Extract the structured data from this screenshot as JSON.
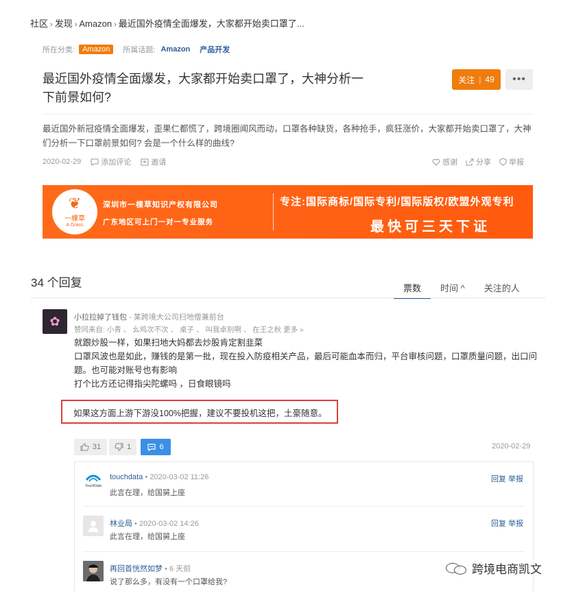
{
  "breadcrumb": {
    "items": [
      "社区",
      "发现",
      "Amazon",
      "最近国外疫情全面爆发，大家都开始卖口罩了..."
    ],
    "separator": "›"
  },
  "meta": {
    "category_label": "所在分类:",
    "category": "Amazon",
    "topics_label": "所属话题:",
    "topics": [
      "Amazon",
      "产品开发"
    ]
  },
  "question": {
    "title": "最近国外疫情全面爆发，大家都开始卖口罩了，大神分析一下前景如何?",
    "follow_label": "关注",
    "follow_count": "49",
    "more_label": "•••",
    "body": "最近国外新冠疫情全面爆发，歪果仁都慌了，跨境圈闻风而动，口罩各种缺货，各种抢手，疯狂涨价，大家都开始卖口罩了，大神们分析一下口罩前景如何? 会是一个什么样的曲线?",
    "date": "2020-02-29",
    "add_comment": "添加评论",
    "invite": "邀请",
    "thanks": "感谢",
    "share": "分享",
    "report": "举报"
  },
  "banner": {
    "logo_text": "一棵草",
    "logo_sub": "A Grass",
    "company": "深圳市一棵草知识产权有限公司",
    "service": "广东地区可上门一对一专业服务",
    "focus": "专注:国际商标/国际专利/国际版权/欧盟外观专利",
    "fast": "最快可三天下证"
  },
  "answers": {
    "count_label": "34 个回复",
    "sort_tabs": [
      "票数",
      "时间 ^",
      "关注的人"
    ],
    "active_sort": "票数"
  },
  "answer": {
    "author": "小拉拉掉了钱包",
    "author_desc": " - 某跨境大公司扫地僧兼前台",
    "likers": "赞同来自: 小青 、 幺鸡次不次 、 桌子 、 叫我卓别啊 、 在王之秋 更多 »",
    "lines": [
      "就跟炒股一样，如果扫地大妈都去炒股肯定割韭菜",
      "口罩风波也是如此，赚钱的是第一批，现在投入防疫相关产品，最后可能血本而归，平台审核问题，口罩质量问题，出口问题。也可能对账号也有影响",
      "打个比方还记得指尖陀螺吗 ，日食眼镜吗"
    ],
    "highlight": "如果这方面上游下游没100%把握，建议不要投机这把，土豪随意。",
    "upvotes": "31",
    "downvotes": "1",
    "comments": "6",
    "date": "2020-02-29"
  },
  "comments": [
    {
      "name": "touchdata",
      "meta": " • 2020-03-02 11:26",
      "text": "此言在理，给国舅上座",
      "ops": "回复 举报",
      "avatar": "touchdata-logo"
    },
    {
      "name": "林业局",
      "meta": " • 2020-03-02 14:26",
      "text": "此言在理，给国舅上座",
      "ops": "回复 举报",
      "avatar": "default-avatar"
    },
    {
      "name": "再回首恍然如梦",
      "meta": " • 6 天前",
      "text": "说了那么多，有没有一个口罩给我?",
      "ops": "",
      "avatar": "photo-avatar"
    }
  ],
  "watermark": {
    "text": "跨境电商凯文"
  },
  "colors": {
    "accent_orange": "#f07c0d",
    "link_blue": "#2b5c94",
    "comment_blue": "#3a8fe6",
    "highlight_red": "#e03b3b",
    "banner_orange": "#ff5a0e"
  }
}
